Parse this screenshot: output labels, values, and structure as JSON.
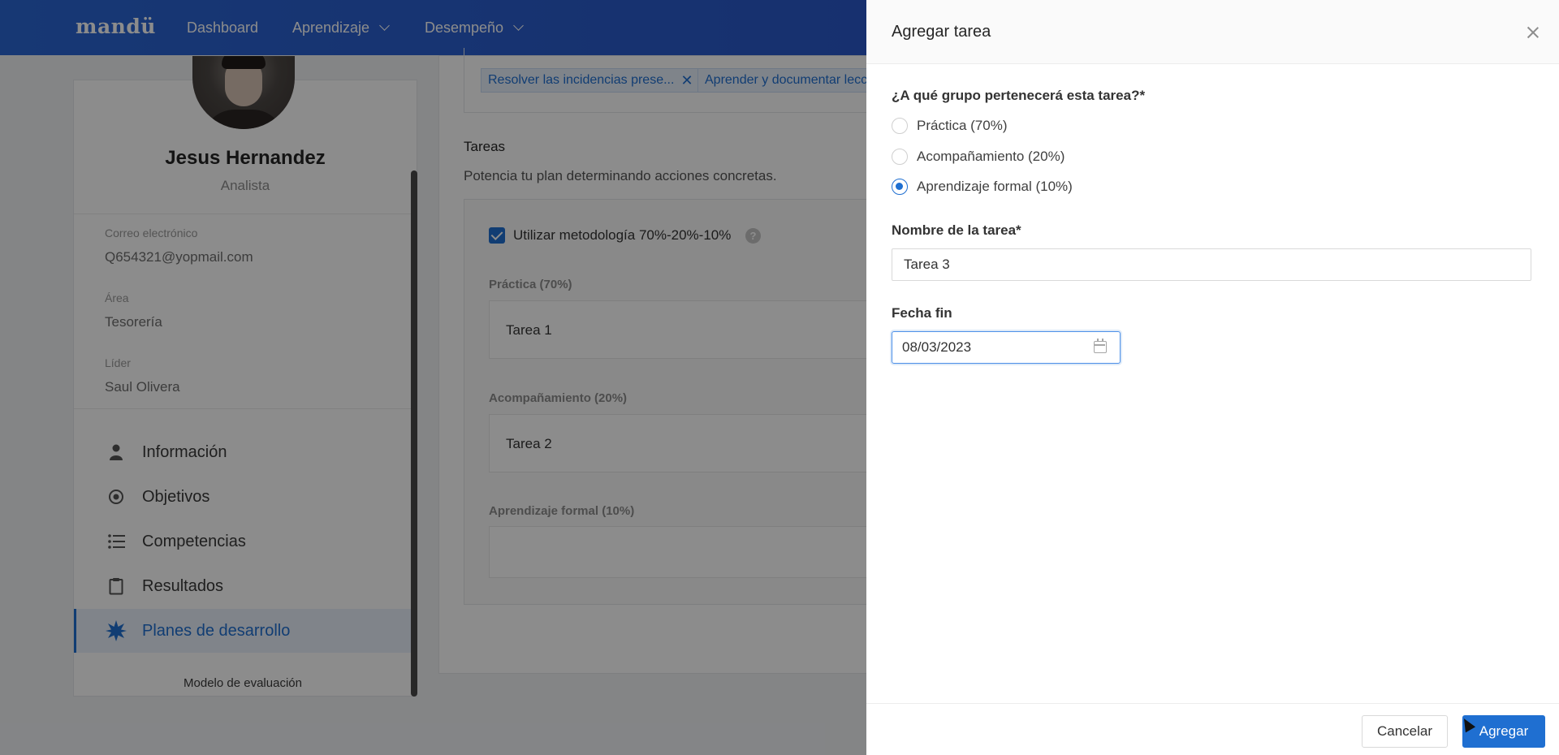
{
  "nav": {
    "logo": "mandü",
    "items": [
      {
        "label": "Dashboard",
        "has_dropdown": false
      },
      {
        "label": "Aprendizaje",
        "has_dropdown": true
      },
      {
        "label": "Desempeño",
        "has_dropdown": true
      }
    ]
  },
  "profile": {
    "name": "Jesus Hernandez",
    "role": "Analista",
    "fields": [
      {
        "label": "Correo electrónico",
        "value": "Q654321@yopmail.com"
      },
      {
        "label": "Área",
        "value": "Tesorería"
      },
      {
        "label": "Líder",
        "value": "Saul Olivera"
      }
    ],
    "menu": [
      {
        "label": "Información",
        "icon": "user-icon",
        "active": false
      },
      {
        "label": "Objetivos",
        "icon": "target-icon",
        "active": false
      },
      {
        "label": "Competencias",
        "icon": "list-icon",
        "active": false
      },
      {
        "label": "Resultados",
        "icon": "clipboard-icon",
        "active": false
      },
      {
        "label": "Planes de desarrollo",
        "icon": "star-burst-icon",
        "active": true
      }
    ],
    "footer_link": "Modelo de evaluación"
  },
  "main": {
    "tags": [
      {
        "label": "Resolver las incidencias prese..."
      },
      {
        "label": "Aprender y documentar lecc"
      }
    ],
    "section_title": "Tareas",
    "section_subtitle": "Potencia tu plan determinando acciones concretas.",
    "methodology_label": "Utilizar metodología 70%-20%-10%",
    "methodology_checked": true,
    "help_glyph": "?",
    "groups": [
      {
        "label": "Práctica (70%)",
        "task": "Tarea 1"
      },
      {
        "label": "Acompañamiento (20%)",
        "task": "Tarea 2"
      },
      {
        "label": "Aprendizaje formal (10%)",
        "task": ""
      }
    ]
  },
  "drawer": {
    "title": "Agregar tarea",
    "question": "¿A qué grupo pertenecerá esta tarea?*",
    "options": [
      {
        "label": "Práctica (70%)",
        "selected": false
      },
      {
        "label": "Acompañamiento (20%)",
        "selected": false
      },
      {
        "label": "Aprendizaje formal (10%)",
        "selected": true
      }
    ],
    "name_label": "Nombre de la tarea*",
    "name_value": "Tarea 3",
    "date_label": "Fecha fin",
    "date_value": "08/03/2023",
    "cancel_label": "Cancelar",
    "add_label": "Agregar"
  },
  "colors": {
    "brand_blue": "#1f6fd1",
    "nav_gradient_start": "#2a66d4",
    "nav_gradient_end": "#2b4fc0"
  }
}
